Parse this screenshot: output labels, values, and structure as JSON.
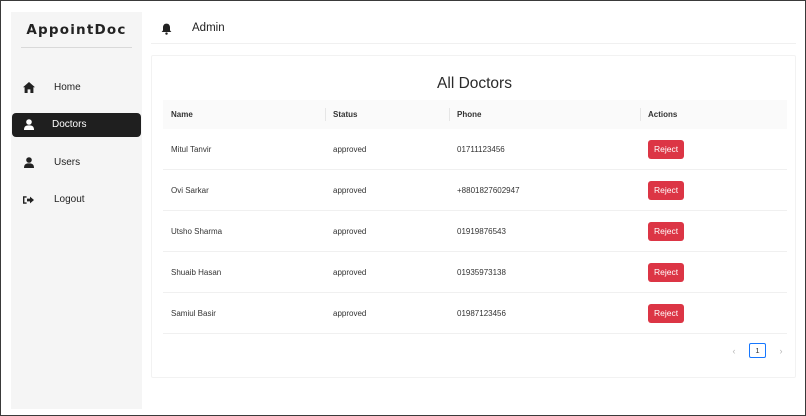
{
  "app": {
    "brand": "AppointDoc"
  },
  "header": {
    "title": "Admin",
    "bell_icon": "bell-icon"
  },
  "sidebar": {
    "items": [
      {
        "label": "Home",
        "icon": "home-icon",
        "active": false
      },
      {
        "label": "Doctors",
        "icon": "user-icon",
        "active": true
      },
      {
        "label": "Users",
        "icon": "user-icon",
        "active": false
      },
      {
        "label": "Logout",
        "icon": "logout-icon",
        "active": false
      }
    ]
  },
  "main": {
    "title": "All Doctors",
    "columns": [
      "Name",
      "Status",
      "Phone",
      "Actions"
    ],
    "rows": [
      {
        "name": "Mitul Tanvir",
        "status": "approved",
        "phone": "01711123456",
        "action": "Reject"
      },
      {
        "name": "Ovi Sarkar",
        "status": "approved",
        "phone": "+8801827602947",
        "action": "Reject"
      },
      {
        "name": "Utsho Sharma",
        "status": "approved",
        "phone": "01919876543",
        "action": "Reject"
      },
      {
        "name": "Shuaib Hasan",
        "status": "approved",
        "phone": "01935973138",
        "action": "Reject"
      },
      {
        "name": "Samiul Basir",
        "status": "approved",
        "phone": "01987123456",
        "action": "Reject"
      }
    ],
    "pagination": {
      "current": "1",
      "prev": "‹",
      "next": "›"
    }
  },
  "colors": {
    "reject": "#dc3545",
    "active_nav": "#1f1f1f",
    "pager_border": "#1677ff"
  }
}
